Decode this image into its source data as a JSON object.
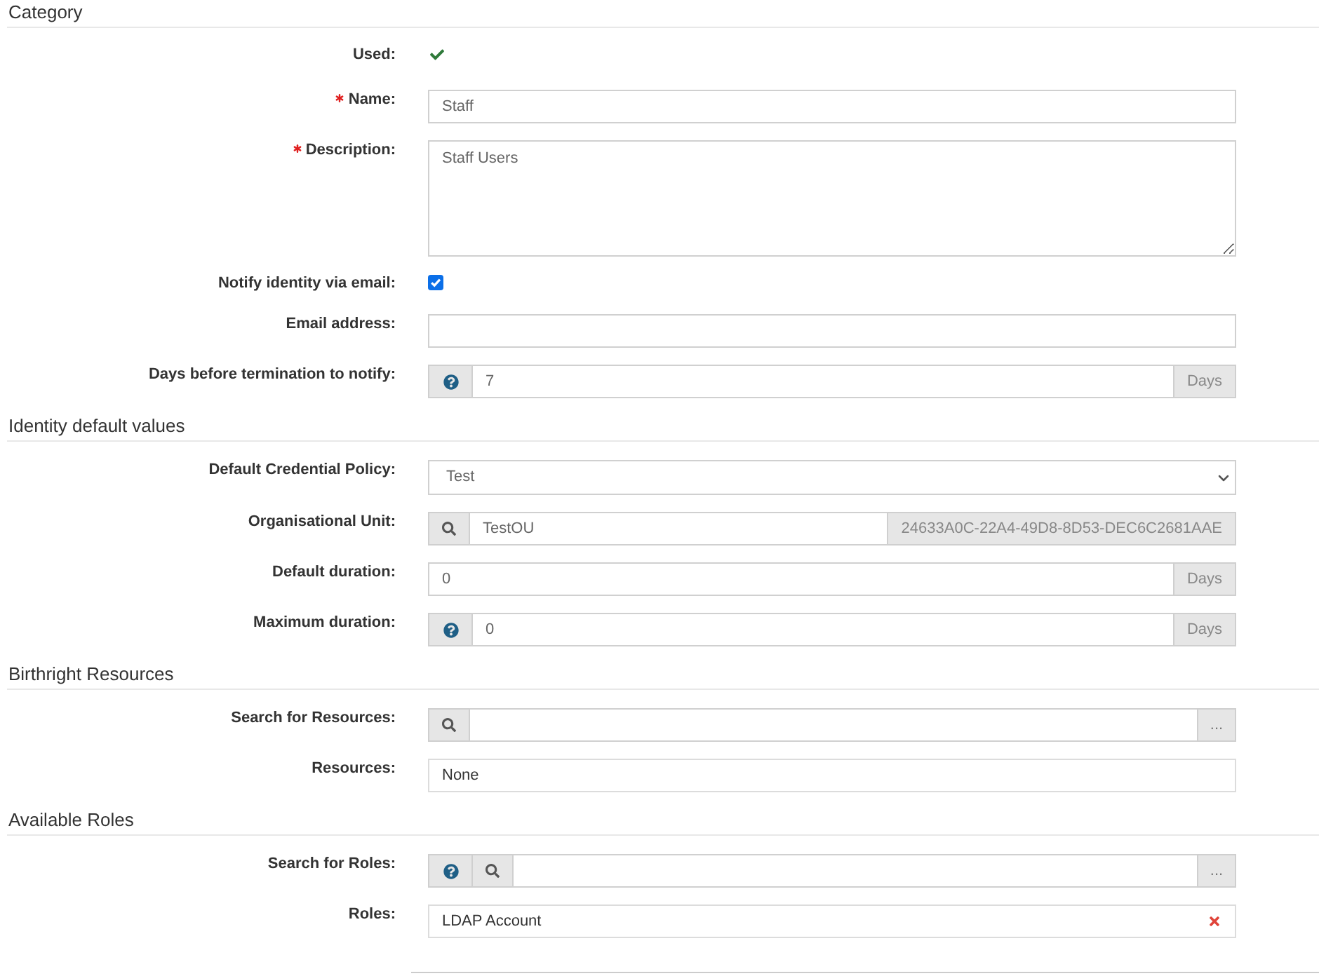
{
  "sections": [
    {
      "title": "Category",
      "fields": [
        {
          "kind": "status",
          "label": "Used:",
          "required": false,
          "checked": true
        },
        {
          "kind": "text",
          "label": "Name:",
          "required": true,
          "value": "Staff"
        },
        {
          "kind": "textarea",
          "label": "Description:",
          "required": true,
          "value": "Staff Users"
        },
        {
          "kind": "checkbox",
          "label": "Notify identity via email:",
          "required": false,
          "checked": true
        },
        {
          "kind": "text",
          "label": "Email address:",
          "required": false
        },
        {
          "kind": "input_group",
          "label": "Days before termination to notify:",
          "required": false,
          "addons": [
            {
              "kind": "help"
            }
          ],
          "value": "7",
          "suffix": "Days"
        }
      ]
    },
    {
      "title": "Identity default values",
      "fields": [
        {
          "kind": "select",
          "label": "Default Credential Policy:",
          "required": false,
          "value": "Test"
        },
        {
          "kind": "input_group",
          "label": "Organisational Unit:",
          "required": false,
          "addons": [
            {
              "kind": "search"
            }
          ],
          "value": "TestOU",
          "suffix": "24633A0C-22A4-49D8-8D53-DEC6C2681AAE"
        },
        {
          "kind": "input_group",
          "label": "Default duration:",
          "required": false,
          "value": "0",
          "suffix": "Days"
        },
        {
          "kind": "input_group",
          "label": "Maximum duration:",
          "required": false,
          "addons": [
            {
              "kind": "help"
            }
          ],
          "value": "0",
          "suffix": "Days"
        }
      ]
    },
    {
      "title": "Birthright Resources",
      "fields": [
        {
          "kind": "input_group",
          "label": "Search for Resources:",
          "required": false,
          "addons": [
            {
              "kind": "search"
            }
          ],
          "button": "..."
        },
        {
          "kind": "list",
          "label": "Resources:",
          "required": false,
          "empty_text": "None"
        }
      ]
    },
    {
      "title": "Available Roles",
      "fields": [
        {
          "kind": "input_group",
          "label": "Search for Roles:",
          "required": false,
          "addons": [
            {
              "kind": "help"
            },
            {
              "kind": "search"
            }
          ],
          "button": "..."
        },
        {
          "kind": "list",
          "label": "Roles:",
          "required": false,
          "items": [
            {
              "text": "LDAP Account",
              "removable": true
            }
          ]
        }
      ]
    }
  ]
}
